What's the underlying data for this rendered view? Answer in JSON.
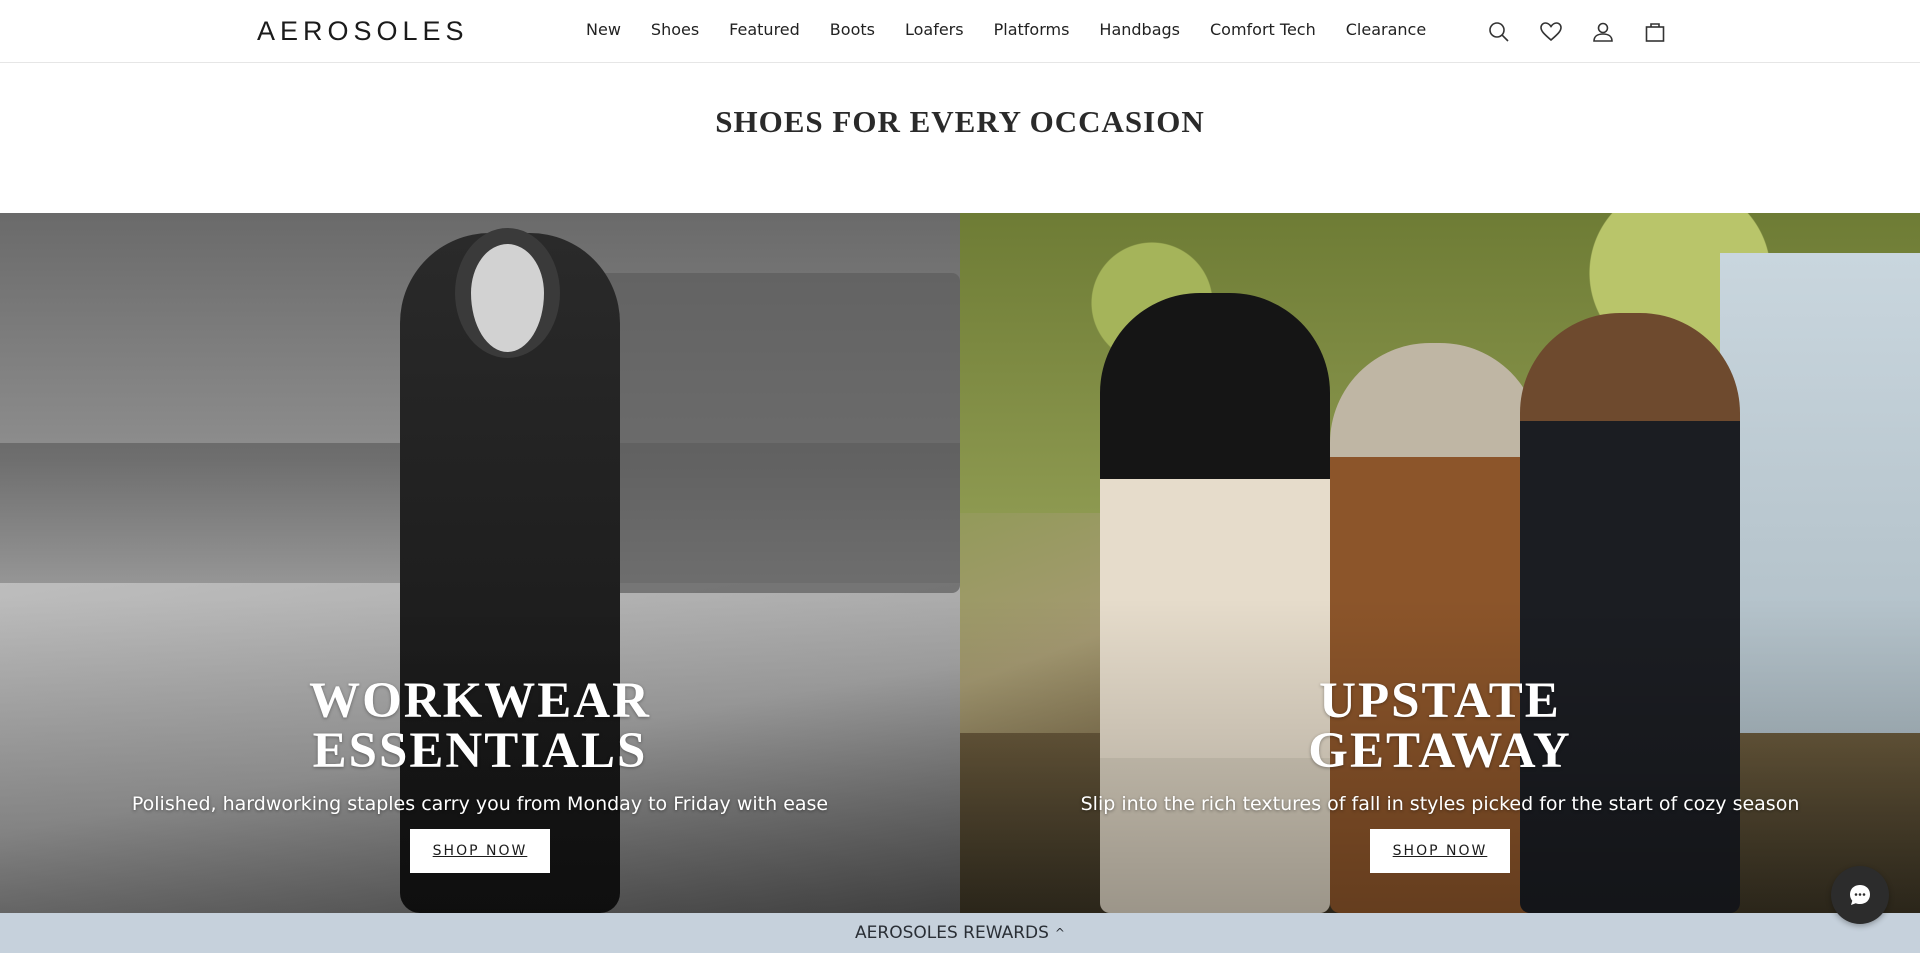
{
  "header": {
    "logo": "AEROSOLES",
    "nav": [
      "New",
      "Shoes",
      "Featured",
      "Boots",
      "Loafers",
      "Platforms",
      "Handbags",
      "Comfort Tech",
      "Clearance"
    ],
    "icons": [
      "search-icon",
      "heart-icon",
      "account-icon",
      "bag-icon"
    ]
  },
  "section": {
    "title": "SHOES FOR EVERY OCCASION"
  },
  "panels": [
    {
      "heading_line1": "WORKWEAR",
      "heading_line2": "ESSENTIALS",
      "subtitle": "Polished, hardworking staples carry you from Monday to Friday with ease",
      "button": "SHOP NOW"
    },
    {
      "heading_line1": "UPSTATE",
      "heading_line2": "GETAWAY",
      "subtitle": "Slip into the rich textures of fall in styles picked for the start of cozy season",
      "button": "SHOP NOW"
    }
  ],
  "rewards": {
    "label": "AEROSOLES REWARDS",
    "chevron": "^"
  },
  "chat": {
    "icon": "chat-icon"
  }
}
